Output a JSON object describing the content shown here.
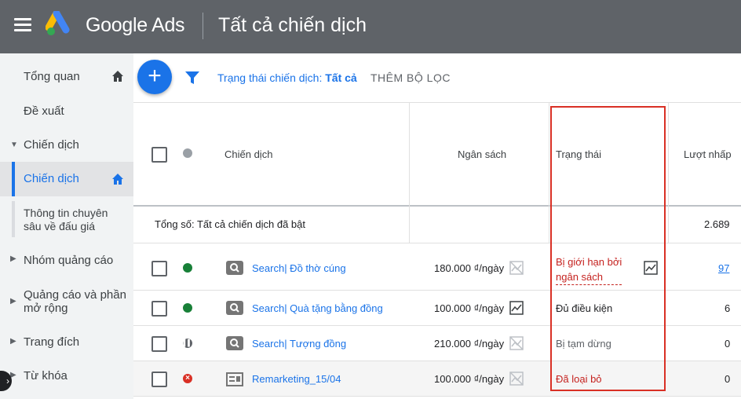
{
  "header": {
    "brand": "Google Ads",
    "title": "Tất cả chiến dịch"
  },
  "sidebar": {
    "items": [
      {
        "label": "Tổng quan",
        "home": true
      },
      {
        "label": "Đề xuất"
      },
      {
        "label": "Chiến dịch",
        "expandable": true,
        "expanded": true
      },
      {
        "label": "Chiến dịch",
        "active": true,
        "home": true
      },
      {
        "label": "Thông tin chuyên sâu về đấu giá"
      },
      {
        "label": "Nhóm quảng cáo",
        "expandable": true
      },
      {
        "label": "Quảng cáo và phần mở rộng",
        "expandable": true
      },
      {
        "label": "Trang đích",
        "expandable": true
      },
      {
        "label": "Từ khóa",
        "expandable": true
      }
    ],
    "sub_lines": [
      "Thông tin chuyên",
      "sâu về đấu giá"
    ],
    "ads_lines": [
      "Quảng cáo và phần",
      "mở rộng"
    ]
  },
  "toolbar": {
    "add_button": "+",
    "filter_label": "Trạng thái chiến dịch:",
    "filter_value": "Tất cả",
    "add_filter": "THÊM BỘ LỌC"
  },
  "table": {
    "columns": [
      "Chiến dịch",
      "Ngân sách",
      "Trạng thái",
      "Lượt nhấp"
    ],
    "total": {
      "label": "Tổng số: Tất cả chiến dịch đã bật",
      "clicks": "2.689"
    },
    "rows": [
      {
        "name": "Search| Đồ thờ cúng",
        "budget": "180.000 ₫/ngày",
        "status_lines": [
          "Bị giới hạn bởi",
          "ngân sách"
        ],
        "status_color": "#c5221f",
        "clicks": "97",
        "state": "enabled"
      },
      {
        "name": "Search| Quà tặng bằng đồng",
        "budget": "100.000 ₫/ngày",
        "status": "Đủ điều kiện",
        "status_color": "#202124",
        "clicks": "6",
        "state": "enabled"
      },
      {
        "name": "Search| Tượng đồng",
        "budget": "210.000 ₫/ngày",
        "status": "Bị tạm dừng",
        "status_color": "#5f6368",
        "clicks": "0",
        "state": "paused"
      },
      {
        "name": "Remarketing_15/04",
        "budget": "100.000 ₫/ngày",
        "status": "Đã loại bỏ",
        "status_color": "#c5221f",
        "clicks": "0",
        "state": "removed"
      }
    ]
  },
  "colors": {
    "accent": "#1a73e8",
    "enabled": "#188038",
    "removed": "#d93025",
    "highlight": "#d93025"
  }
}
